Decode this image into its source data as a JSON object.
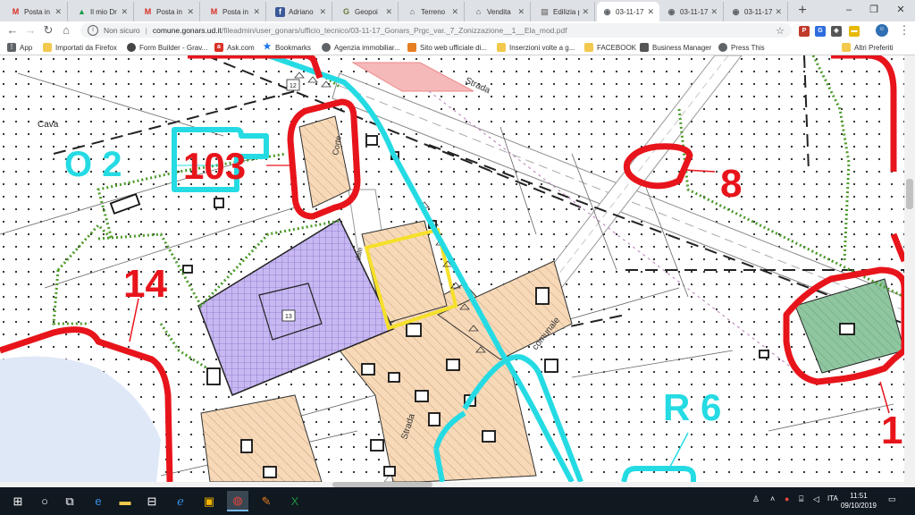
{
  "tabs": [
    {
      "label": "Posta in a",
      "icon": "gmail-icon",
      "letter": "M",
      "color": "#d93025",
      "closable": true
    },
    {
      "label": "Il mio Dr",
      "icon": "drive-icon",
      "letter": "▲",
      "color": "#1a9e4b",
      "closable": true
    },
    {
      "label": "Posta in a",
      "icon": "gmail-icon",
      "letter": "M",
      "color": "#d93025",
      "closable": true
    },
    {
      "label": "Posta in a",
      "icon": "gmail-icon",
      "letter": "M",
      "color": "#d93025",
      "closable": true
    },
    {
      "label": "Adriano",
      "icon": "facebook-icon",
      "letter": "f",
      "color": "#3b5998",
      "closable": true
    },
    {
      "label": "Geopoi",
      "icon": "geopoi-icon",
      "letter": "G",
      "color": "#6b7a3a",
      "closable": true
    },
    {
      "label": "Terreno",
      "icon": "home-icon",
      "letter": "⌂",
      "color": "#555555",
      "closable": true
    },
    {
      "label": "Vendita",
      "icon": "home-icon",
      "letter": "⌂",
      "color": "#555555",
      "closable": true
    },
    {
      "label": "Edilizia p",
      "icon": "page-icon",
      "letter": "▤",
      "color": "#888888",
      "closable": true
    },
    {
      "label": "03-11-17",
      "icon": "globe-icon",
      "letter": "◉",
      "color": "#5f6368",
      "closable": true,
      "active": true
    },
    {
      "label": "03-11-17",
      "icon": "globe-icon",
      "letter": "◉",
      "color": "#5f6368",
      "closable": true
    },
    {
      "label": "03-11-17",
      "icon": "globe-icon",
      "letter": "◉",
      "color": "#5f6368",
      "closable": true
    }
  ],
  "window": {
    "minimize": "–",
    "maximize": "❐",
    "close": "✕",
    "new_tab": "+"
  },
  "address": {
    "security": "Non sicuro",
    "host": "comune.gonars.ud.it",
    "path": "/fileadmin/user_gonars/ufficio_tecnico/03-11-17_Gonars_Prgc_var._7_Zonizzazione__1__Ela_mod.pdf"
  },
  "bookmarks": [
    {
      "label": "App",
      "icon": "apps-icon",
      "color": "#5f6368"
    },
    {
      "label": "Importati da Firefox",
      "icon": "folder-icon",
      "color": "#f2c94c"
    },
    {
      "label": "Form Builder - Grav...",
      "icon": "form-icon",
      "color": "#444444"
    },
    {
      "label": "Ask.com",
      "icon": "ask-icon",
      "color": "#d93025"
    },
    {
      "label": "Bookmarks",
      "icon": "star-icon",
      "color": "#1a73e8"
    },
    {
      "label": "Agenzia immobiliar...",
      "icon": "globe-icon",
      "color": "#5f6368"
    },
    {
      "label": "Sito web ufficiale di...",
      "icon": "site-icon",
      "color": "#e67e22"
    },
    {
      "label": "Inserzioni volte a g...",
      "icon": "folder-icon",
      "color": "#f2c94c"
    },
    {
      "label": "FACEBOOK",
      "icon": "folder-icon",
      "color": "#f2c94c"
    },
    {
      "label": "Business Manager",
      "icon": "business-icon",
      "color": "#555555"
    },
    {
      "label": "Press This",
      "icon": "globe-icon",
      "color": "#5f6368"
    }
  ],
  "bookmarks_other": "Altri Preferiti",
  "map_labels": {
    "cava": "Cava",
    "zone_o2": "O 2",
    "zone_103": "103",
    "zone_8": "8",
    "zone_14": "14",
    "zone_r6": "R 6",
    "zone_1x": "1",
    "road_corte": "Corte",
    "road_strada_top": "Strada",
    "road_strada_bottom": "Strada",
    "road_comunale": "comunale",
    "road_dale": "dale",
    "lot_12": "12",
    "lot_13": "13"
  },
  "map_colors": {
    "zone_red": "#e8141b",
    "zone_cyan": "#25dbe3",
    "zone_yellow": "#f5e02a",
    "hatch_orange": "#f7d9b8",
    "hatch_purple": "#c8b8f2",
    "water": "#dfe8f7",
    "green_zone": "#8fc6a0",
    "green_dotted": "#4c9a2a"
  },
  "taskbar": {
    "clock_time": "11:51",
    "clock_date": "09/10/2019",
    "language": "ITA",
    "apps": [
      "windows-start-icon",
      "search-icon",
      "task-view-icon",
      "edge-icon",
      "file-explorer-icon",
      "store-icon",
      "ie-icon",
      "chrome-icon",
      "paint-icon",
      "excel-icon"
    ]
  }
}
